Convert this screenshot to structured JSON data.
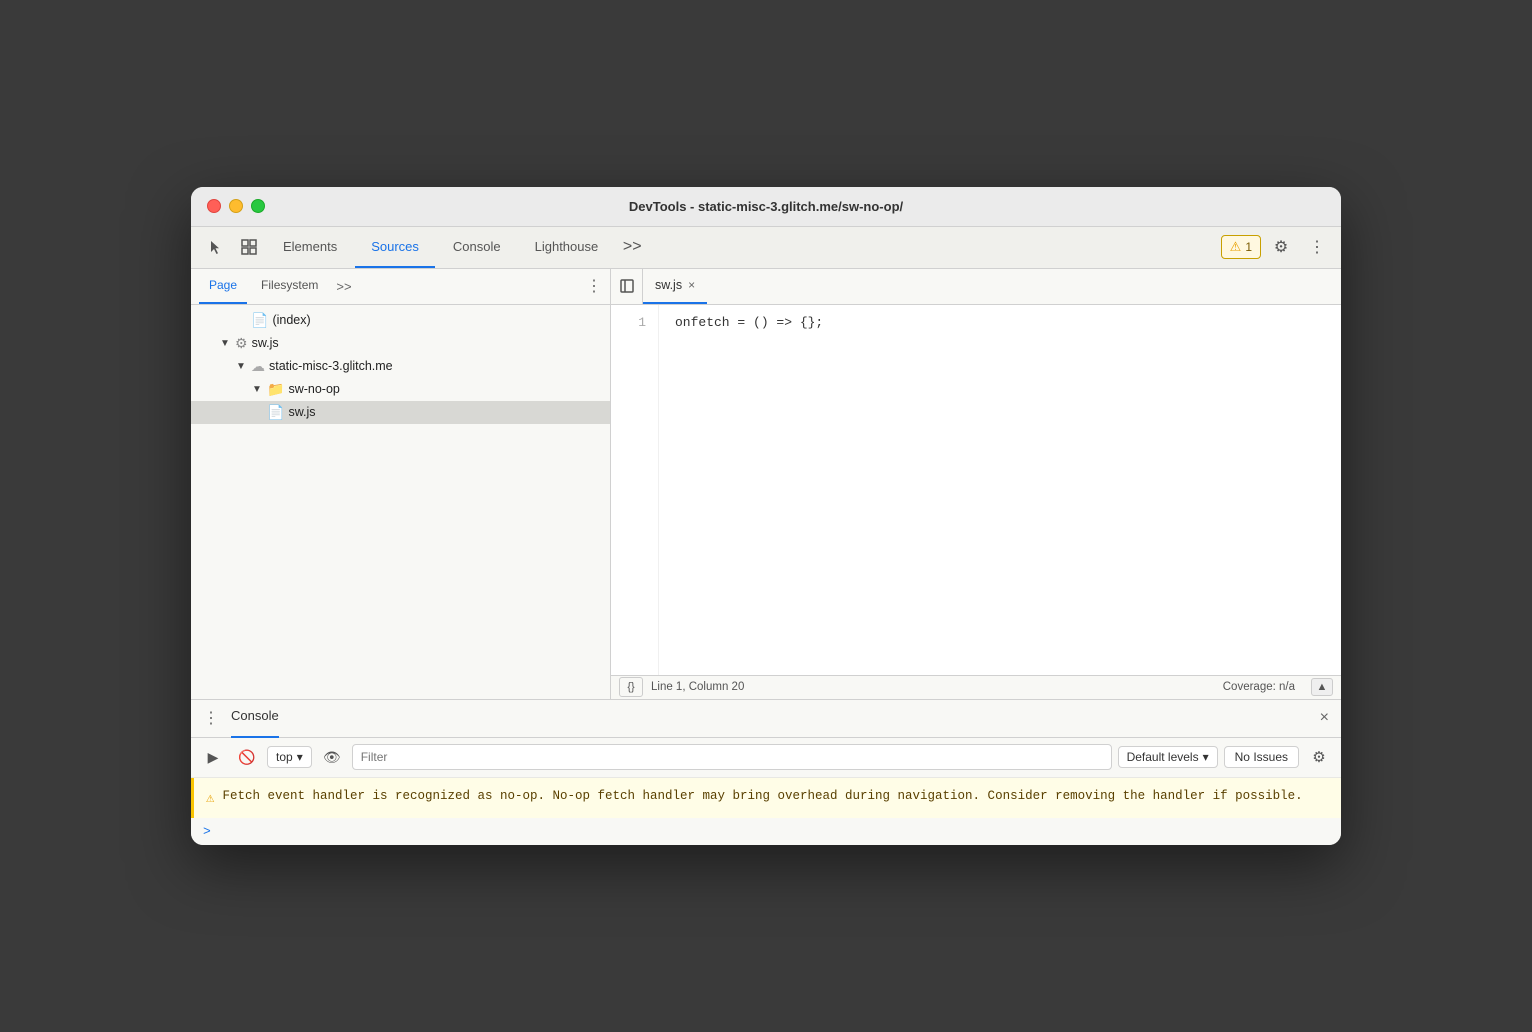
{
  "window": {
    "title": "DevTools - static-misc-3.glitch.me/sw-no-op/"
  },
  "devtools_toolbar": {
    "tabs": [
      "Elements",
      "Sources",
      "Console",
      "Lighthouse"
    ],
    "active_tab": "Sources",
    "more_tabs_label": ">>",
    "warning_count": "1",
    "gear_label": "⚙",
    "menu_label": "⋮"
  },
  "sidebar": {
    "tabs": [
      "Page",
      "Filesystem"
    ],
    "active_tab": "Page",
    "more_label": ">>",
    "file_tree": [
      {
        "indent": 4,
        "arrow": "",
        "icon": "📄",
        "label": "(index)",
        "type": "file"
      },
      {
        "indent": 2,
        "arrow": "▼",
        "icon": "⚙",
        "label": "sw.js",
        "type": "swjs"
      },
      {
        "indent": 4,
        "arrow": "▼",
        "icon": "☁",
        "label": "static-misc-3.glitch.me",
        "type": "domain"
      },
      {
        "indent": 6,
        "arrow": "▼",
        "icon": "📁",
        "label": "sw-no-op",
        "type": "folder"
      },
      {
        "indent": 8,
        "arrow": "",
        "icon": "📄",
        "label": "sw.js",
        "type": "jsfile",
        "selected": true
      }
    ]
  },
  "editor": {
    "tab_label": "sw.js",
    "line_numbers": [
      "1"
    ],
    "code_lines": [
      "onfetch = () => {};"
    ],
    "status": {
      "format_label": "{}",
      "position": "Line 1, Column 20",
      "coverage": "Coverage: n/a"
    }
  },
  "console": {
    "title": "Console",
    "toolbar": {
      "play_icon": "▶",
      "block_icon": "🚫",
      "context_label": "top",
      "context_arrow": "▾",
      "eye_icon": "👁",
      "filter_placeholder": "Filter",
      "levels_label": "Default levels",
      "levels_arrow": "▾",
      "no_issues_label": "No Issues"
    },
    "warning_message": "Fetch event handler is recognized as no-op. No-op fetch handler may bring overhead during navigation. Consider removing the handler if possible.",
    "prompt_caret": ">"
  }
}
